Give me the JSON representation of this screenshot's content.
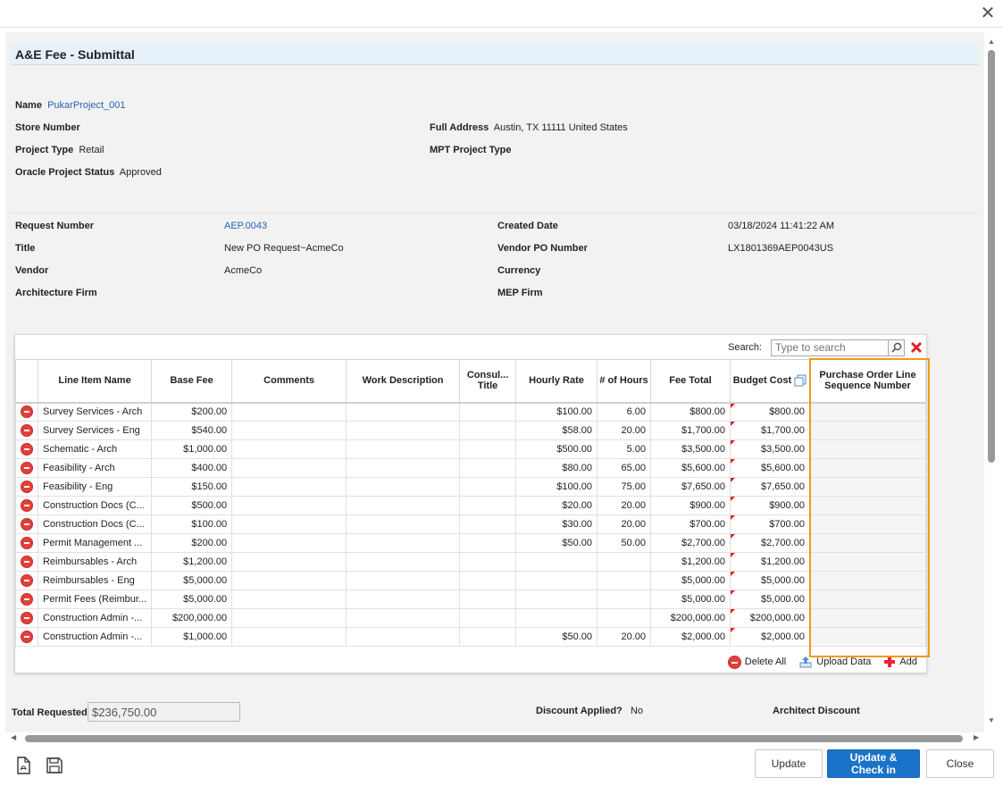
{
  "dialog": {
    "close_symbol": "✕"
  },
  "header": {
    "title": "A&E Fee - Submittal"
  },
  "project": {
    "name_label": "Name",
    "name_value": "PukarProject_001",
    "store_label": "Store Number",
    "address_label": "Full Address",
    "address_value": "Austin, TX 11111 United States",
    "type_label": "Project Type",
    "type_value": "Retail",
    "mpt_label": "MPT Project Type",
    "status_label": "Oracle Project Status",
    "status_value": "Approved"
  },
  "request": {
    "number_label": "Request Number",
    "number_value": "AEP.0043",
    "created_label": "Created Date",
    "created_value": "03/18/2024 11:41:22 AM",
    "title_label": "Title",
    "title_value": "New PO Request~AcmeCo",
    "vendor_po_label": "Vendor PO Number",
    "vendor_po_value": "LX1801369AEP0043US",
    "vendor_label": "Vendor",
    "vendor_value": "AcmeCo",
    "currency_label": "Currency",
    "arch_label": "Architecture Firm",
    "mep_label": "MEP Firm"
  },
  "grid": {
    "search_label": "Search:",
    "search_placeholder": "Type to search",
    "columns": [
      "Line Item Name",
      "Base Fee",
      "Comments",
      "Work Description",
      "Consul... Title",
      "Hourly Rate",
      "# of Hours",
      "Fee Total",
      "Budget Cost",
      "Purchase Order Line Sequence Number"
    ],
    "rows": [
      {
        "name": "Survey Services - Arch",
        "base": "$200.00",
        "rate": "$100.00",
        "hours": "6.00",
        "total": "$800.00",
        "budget": "$800.00"
      },
      {
        "name": "Survey Services - Eng",
        "base": "$540.00",
        "rate": "$58.00",
        "hours": "20.00",
        "total": "$1,700.00",
        "budget": "$1,700.00"
      },
      {
        "name": "Schematic - Arch",
        "base": "$1,000.00",
        "rate": "$500.00",
        "hours": "5.00",
        "total": "$3,500.00",
        "budget": "$3,500.00"
      },
      {
        "name": "Feasibility - Arch",
        "base": "$400.00",
        "rate": "$80.00",
        "hours": "65.00",
        "total": "$5,600.00",
        "budget": "$5,600.00"
      },
      {
        "name": "Feasibility - Eng",
        "base": "$150.00",
        "rate": "$100.00",
        "hours": "75.00",
        "total": "$7,650.00",
        "budget": "$7,650.00"
      },
      {
        "name": "Construction Docs (C...",
        "base": "$500.00",
        "rate": "$20.00",
        "hours": "20.00",
        "total": "$900.00",
        "budget": "$900.00"
      },
      {
        "name": "Construction Docs (C...",
        "base": "$100.00",
        "rate": "$30.00",
        "hours": "20.00",
        "total": "$700.00",
        "budget": "$700.00"
      },
      {
        "name": "Permit Management ...",
        "base": "$200.00",
        "rate": "$50.00",
        "hours": "50.00",
        "total": "$2,700.00",
        "budget": "$2,700.00"
      },
      {
        "name": "Reimbursables - Arch",
        "base": "$1,200.00",
        "rate": "",
        "hours": "",
        "total": "$1,200.00",
        "budget": "$1,200.00"
      },
      {
        "name": "Reimbursables - Eng",
        "base": "$5,000.00",
        "rate": "",
        "hours": "",
        "total": "$5,000.00",
        "budget": "$5,000.00"
      },
      {
        "name": "Permit Fees (Reimbur...",
        "base": "$5,000.00",
        "rate": "",
        "hours": "",
        "total": "$5,000.00",
        "budget": "$5,000.00"
      },
      {
        "name": "Construction Admin -...",
        "base": "$200,000.00",
        "rate": "",
        "hours": "",
        "total": "$200,000.00",
        "budget": "$200,000.00"
      },
      {
        "name": "Construction Admin -...",
        "base": "$1,000.00",
        "rate": "$50.00",
        "hours": "20.00",
        "total": "$2,000.00",
        "budget": "$2,000.00"
      }
    ],
    "delete_all_label": "Delete All",
    "upload_label": "Upload Data",
    "add_label": "Add"
  },
  "totals": {
    "requested_label": "Total Requested",
    "requested_value": "$236,750.00",
    "discount_label": "Discount Applied?",
    "discount_value": "No",
    "architect_discount_label": "Architect Discount"
  },
  "footer": {
    "update_label": "Update",
    "update_checkin_label": "Update & Check in",
    "close_label": "Close"
  },
  "colors": {
    "primary": "#1a73c9",
    "highlight": "#f09a1a",
    "delete": "#e0413a",
    "link": "#2a62b5"
  }
}
